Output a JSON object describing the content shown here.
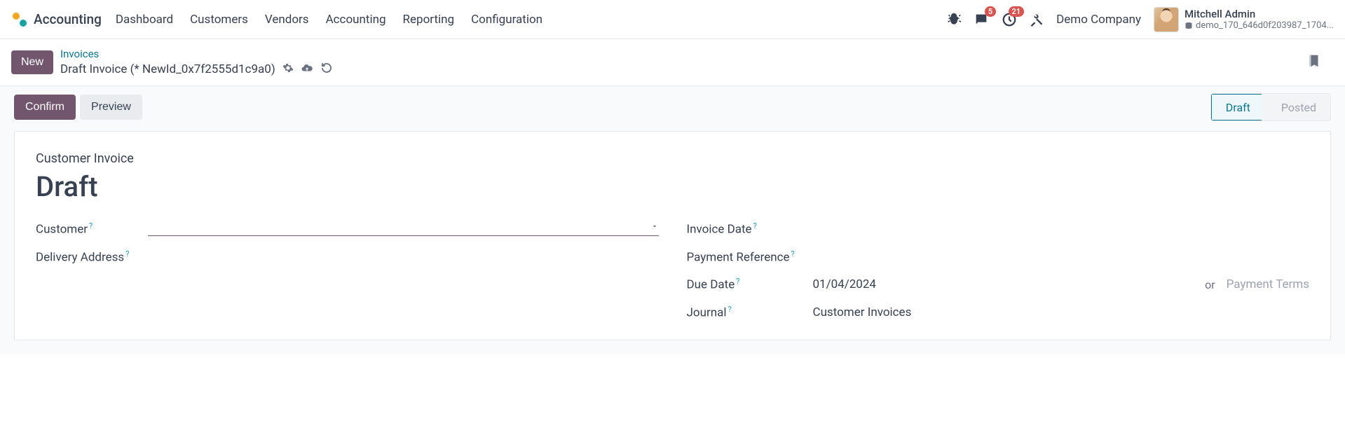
{
  "header": {
    "brand": "Accounting",
    "nav": [
      "Dashboard",
      "Customers",
      "Vendors",
      "Accounting",
      "Reporting",
      "Configuration"
    ],
    "messages_badge": "5",
    "activities_badge": "21",
    "company": "Demo Company",
    "user_name": "Mitchell Admin",
    "db_name": "demo_170_646d0f203987_1704..."
  },
  "subheader": {
    "new_button": "New",
    "breadcrumb_parent": "Invoices",
    "breadcrumb_current": "Draft Invoice (* NewId_0x7f2555d1c9a0)"
  },
  "actions": {
    "confirm": "Confirm",
    "preview": "Preview",
    "status_draft": "Draft",
    "status_posted": "Posted"
  },
  "form": {
    "doc_type": "Customer Invoice",
    "doc_title": "Draft",
    "labels": {
      "customer": "Customer",
      "delivery_address": "Delivery Address",
      "invoice_date": "Invoice Date",
      "payment_reference": "Payment Reference",
      "due_date": "Due Date",
      "journal": "Journal"
    },
    "values": {
      "customer": "",
      "due_date": "01/04/2024",
      "due_date_or": "or",
      "payment_terms_placeholder": "Payment Terms",
      "journal": "Customer Invoices"
    }
  }
}
